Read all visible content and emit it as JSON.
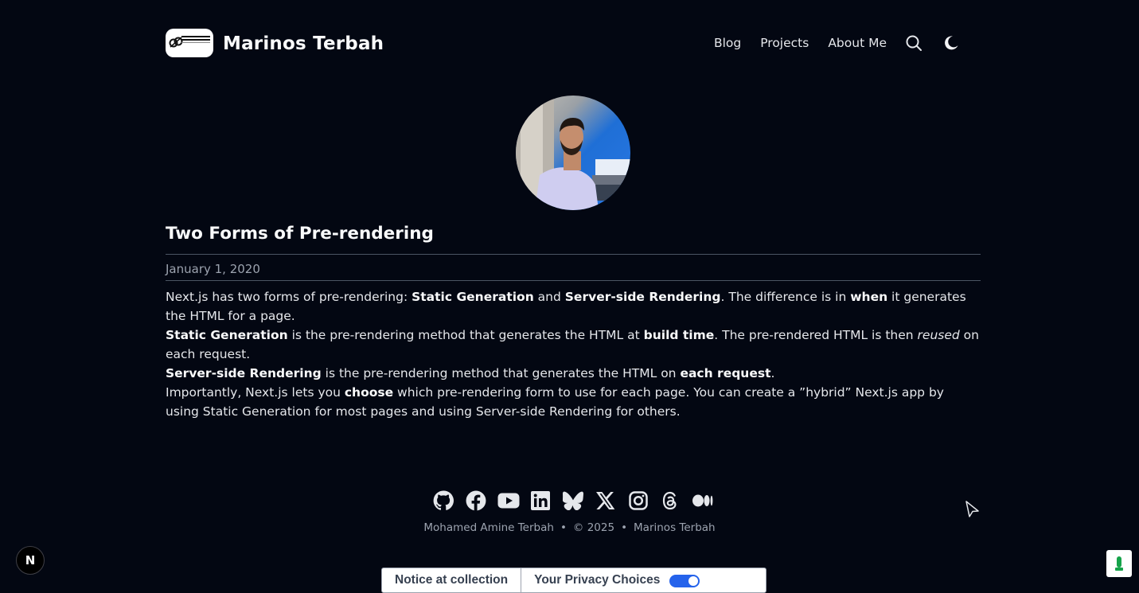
{
  "header": {
    "site_title": "Marinos Terbah",
    "logo_alt": "MOHAMED AMINE TERBAH",
    "nav": [
      {
        "label": "Blog"
      },
      {
        "label": "Projects"
      },
      {
        "label": "About Me"
      }
    ],
    "icons": [
      "search-icon",
      "moon-icon"
    ]
  },
  "post": {
    "title": "Two Forms of Pre-rendering",
    "date": "January 1, 2020",
    "p1": {
      "a": "Next.js has two forms of pre-rendering: ",
      "b": "Static Generation",
      "c": " and ",
      "d": "Server-side Rendering",
      "e": ". The difference is in ",
      "f": "when",
      "g": " it generates the HTML for a page."
    },
    "p2": {
      "a": "Static Generation",
      "b": " is the pre-rendering method that generates the HTML at ",
      "c": "build time",
      "d": ". The pre-rendered HTML is then ",
      "e": "reused",
      "f": " on each request."
    },
    "p3": {
      "a": "Server-side Rendering",
      "b": " is the pre-rendering method that generates the HTML on ",
      "c": "each request",
      "d": "."
    },
    "p4": {
      "a": "Importantly, Next.js lets you ",
      "b": "choose",
      "c": " which pre-rendering form to use for each page. You can create a ”hybrid” Next.js app by using Static Generation for most pages and using Server-side Rendering for others."
    }
  },
  "footer": {
    "social_icons": [
      "github-icon",
      "facebook-icon",
      "youtube-icon",
      "linkedin-icon",
      "bluesky-icon",
      "x-icon",
      "instagram-icon",
      "threads-icon",
      "medium-icon"
    ],
    "author": "Mohamed Amine Terbah",
    "bullet": "•",
    "copyright": "© 2025",
    "site": "Marinos Terbah"
  },
  "overlays": {
    "n_badge": "N",
    "privacy_notice": "Notice at collection",
    "privacy_choices": "Your Privacy Choices"
  },
  "colors": {
    "background": "#030712",
    "text": "#e5e7eb",
    "muted": "#9ca3af",
    "toggle": "#2563eb"
  }
}
